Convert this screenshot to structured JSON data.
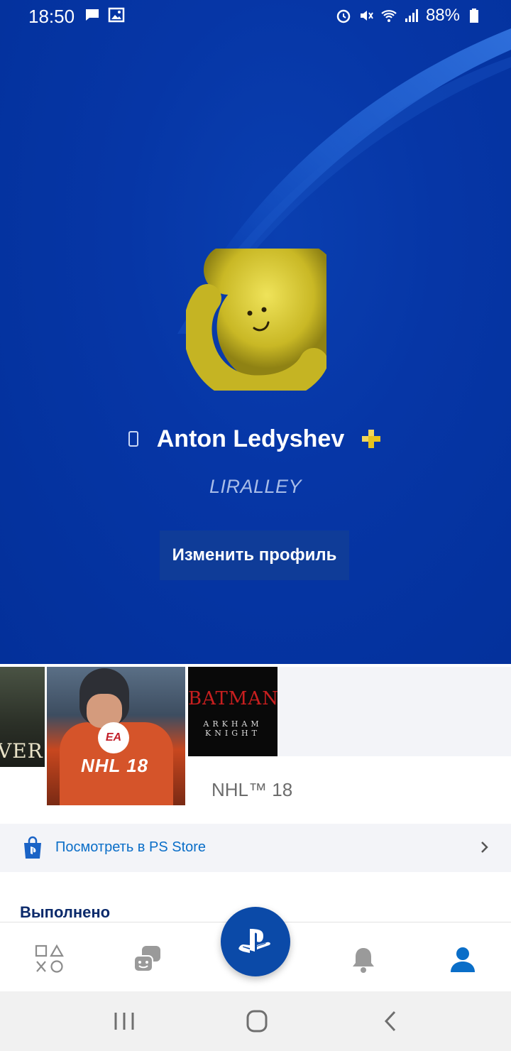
{
  "status_bar": {
    "time": "18:50",
    "battery": "88%",
    "left_icons": [
      "chat-bubble-icon",
      "image-icon"
    ],
    "right_icons": [
      "alarm-icon",
      "mute-icon",
      "wifi-icon",
      "signal-icon",
      "battery-icon"
    ]
  },
  "profile": {
    "name": "Anton Ledyshev",
    "psn_id": "LIRALLEY",
    "edit_button": "Изменить профиль",
    "avatar": "yellow-smiley-avatar",
    "device_icon": "mobile-device-icon",
    "plus_icon": "ps-plus-icon"
  },
  "games": {
    "covers": [
      {
        "label": "VER.",
        "name": "partial-game-cover"
      },
      {
        "label": "NHL 18",
        "badge": "EA SPORTS",
        "name": "nhl-18-cover"
      },
      {
        "label": "BATMAN",
        "sublabel": "ARKHAM KNIGHT",
        "name": "batman-arkham-knight-cover"
      }
    ],
    "selected_title": "NHL™ 18"
  },
  "store": {
    "label": "Посмотреть в PS Store",
    "icon": "ps-store-bag-icon"
  },
  "section": {
    "done_label": "Выполнено"
  },
  "tabbar": {
    "tabs": [
      "games-tab",
      "friends-tab",
      "playstation-home",
      "notifications-tab",
      "profile-tab"
    ],
    "active": "profile-tab",
    "active_color": "#0a6ec8"
  },
  "colors": {
    "hero_blue": "#0636a6",
    "accent_blue": "#0a6ec8",
    "heading_navy": "#0b2a6b"
  }
}
